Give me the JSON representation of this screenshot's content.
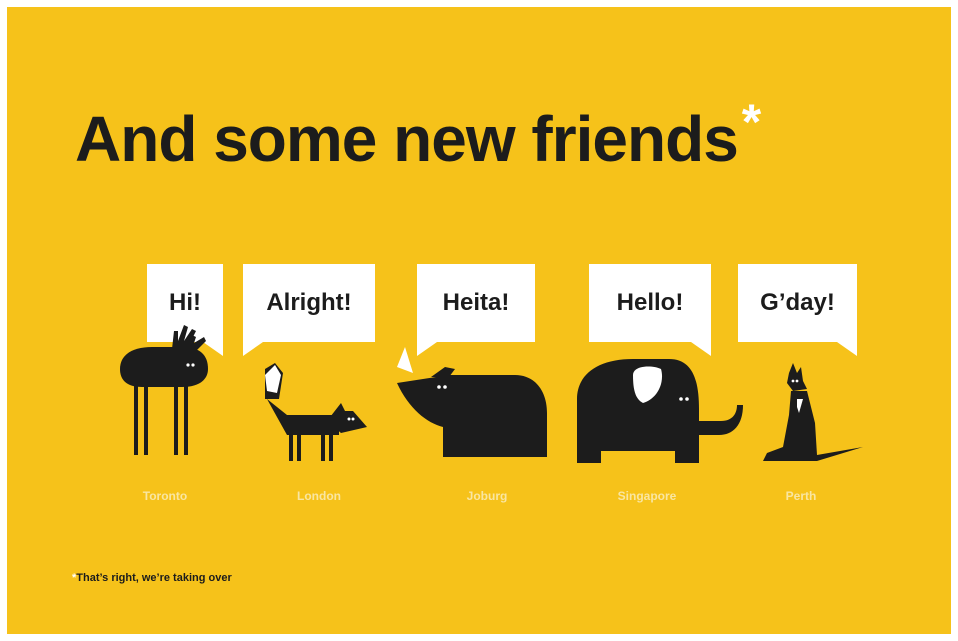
{
  "headline": {
    "text": "And some new friends",
    "asterisk": "*"
  },
  "friends": [
    {
      "greeting": "Hi!",
      "city": "Toronto",
      "animal": "moose-icon"
    },
    {
      "greeting": "Alright!",
      "city": "London",
      "animal": "fox-icon"
    },
    {
      "greeting": "Heita!",
      "city": "Joburg",
      "animal": "rhino-icon"
    },
    {
      "greeting": "Hello!",
      "city": "Singapore",
      "animal": "elephant-icon"
    },
    {
      "greeting": "G’day!",
      "city": "Perth",
      "animal": "kangaroo-icon"
    }
  ],
  "footnote": {
    "asterisk": "*",
    "text": "That’s right, we’re taking over"
  },
  "colors": {
    "background": "#f6c21a",
    "ink": "#1c1c1c",
    "bubble": "#ffffff"
  }
}
